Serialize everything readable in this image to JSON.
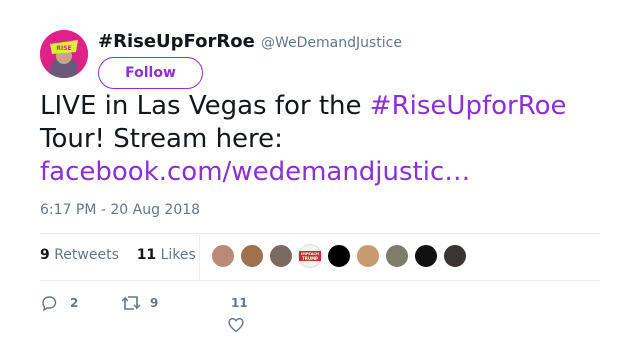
{
  "user": {
    "name": "#RiseUpForRoe",
    "handle": "@WeDemandJustice",
    "follow_label": "Follow"
  },
  "tweet": {
    "text_line1_prefix": "LIVE in Las Vegas for the ",
    "hashtag": "#RiseUpforRoe",
    "text_line2": "Tour! Stream here:",
    "link": "facebook.com/wedemandjustic…",
    "timestamp": "6:17 PM - 20 Aug 2018"
  },
  "stats": {
    "retweets_count": "9",
    "retweets_label": "Retweets",
    "likes_count": "11",
    "likes_label": "Likes"
  },
  "likers": [
    {
      "name": "liker-1",
      "color": "#b98a7a"
    },
    {
      "name": "liker-2",
      "color": "#a0704a"
    },
    {
      "name": "liker-3",
      "color": "#7a6a60"
    },
    {
      "name": "liker-4",
      "color": "#c8302e",
      "text": "IMPEACH TRUMP"
    },
    {
      "name": "liker-5",
      "color": "#000000"
    },
    {
      "name": "liker-6",
      "color": "#c89a70"
    },
    {
      "name": "liker-7",
      "color": "#7d7d6a"
    },
    {
      "name": "liker-8",
      "color": "#111111"
    },
    {
      "name": "liker-9",
      "color": "#3a3532"
    }
  ],
  "actions": {
    "reply_count": "2",
    "retweet_count": "9",
    "like_count": "11"
  },
  "colors": {
    "accent": "#8b2fd6",
    "avatar_bg": "#e0218a",
    "muted": "#657786"
  }
}
